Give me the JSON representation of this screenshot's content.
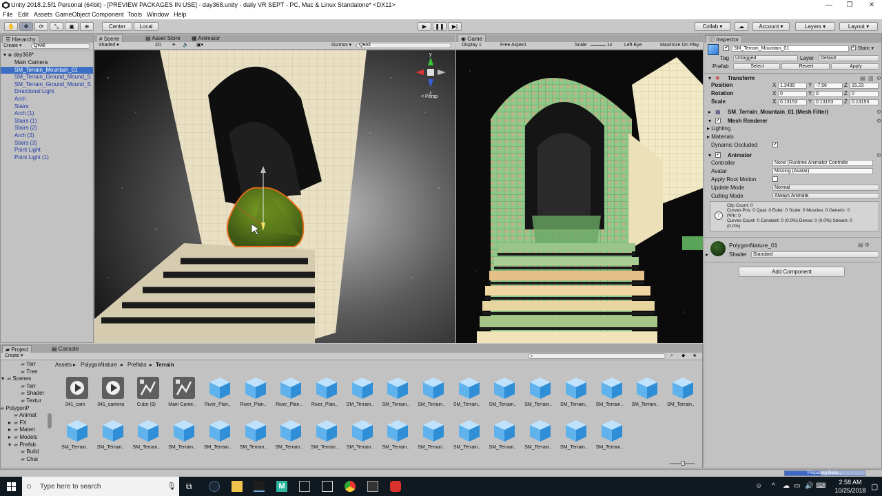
{
  "window": {
    "title": "Unity 2018.2.5f1 Personal (64bit) - [PREVIEW PACKAGES IN USE] - day368.unity - daily VR SEPT - PC, Mac & Linux Standalone* <DX11>"
  },
  "menu": [
    "File",
    "Edit",
    "Assets",
    "GameObject",
    "Component",
    "Tools",
    "Window",
    "Help"
  ],
  "toolbar": {
    "center": "Center",
    "local": "Local",
    "collab": "Collab ▾",
    "account": "Account",
    "layers": "Layers",
    "layout": "Layout"
  },
  "hierarchy": {
    "tab": "Hierarchy",
    "create": "Create ▾",
    "search": "Q▾All",
    "scene": "day368*",
    "items": [
      {
        "label": "Main Camera",
        "style": "normal"
      },
      {
        "label": "SM_Terrain_Mountain_01",
        "style": "selected"
      },
      {
        "label": "SM_Terrain_Ground_Mound_S",
        "style": "prefab"
      },
      {
        "label": "SM_Terrain_Ground_Mound_S",
        "style": "prefab"
      },
      {
        "label": "Directional Light",
        "style": "prefab"
      },
      {
        "label": "Arch",
        "style": "prefab"
      },
      {
        "label": "Stairs",
        "style": "prefab"
      },
      {
        "label": "Arch (1)",
        "style": "prefab"
      },
      {
        "label": "Stairs (1)",
        "style": "prefab"
      },
      {
        "label": "Stairs (2)",
        "style": "prefab"
      },
      {
        "label": "Arch (2)",
        "style": "prefab"
      },
      {
        "label": "Stairs (3)",
        "style": "prefab"
      },
      {
        "label": "Point Light",
        "style": "prefab"
      },
      {
        "label": "Point Light (1)",
        "style": "prefab"
      }
    ]
  },
  "scene": {
    "tabs": [
      "Scene",
      "Asset Store",
      "Animator"
    ],
    "shading": "Shaded",
    "mode2d": "2D",
    "gizmos": "Gizmos ▾",
    "search": "Q▾All",
    "persp": "< Persp",
    "axis_y": "y",
    "axis_z": "z"
  },
  "game": {
    "tab": "Game",
    "display": "Display 1",
    "aspect": "Free Aspect",
    "scale_label": "Scale",
    "scale_value": "1x",
    "eye": "Left Eye",
    "maximize": "Maximize On Play"
  },
  "inspector": {
    "tab": "Inspector",
    "object_name": "SM_Terrain_Mountain_01",
    "static": "Static ▾",
    "tag_label": "Tag",
    "tag_value": "Untagged",
    "layer_label": "Layer",
    "layer_value": "Default",
    "prefab_label": "Prefab",
    "prefab_select": "Select",
    "prefab_revert": "Revert",
    "prefab_apply": "Apply",
    "transform": {
      "title": "Transform",
      "position": {
        "label": "Position",
        "x": "1.3499",
        "y": "-7.56",
        "z": "15.23"
      },
      "rotation": {
        "label": "Rotation",
        "x": "0",
        "y": "0",
        "z": "0"
      },
      "scale": {
        "label": "Scale",
        "x": "0.13153",
        "y": "0.13153",
        "z": "0.13153"
      }
    },
    "mesh_filter": "SM_Terrain_Mountain_01 (Mesh Filter)",
    "mesh_renderer": "Mesh Renderer",
    "lighting": "Lighting",
    "materials": "Materials",
    "dynamic_occluded": "Dynamic Occluded",
    "animator": {
      "title": "Animator",
      "controller_label": "Controller",
      "controller_value": "None (Runtime Animator Controlle",
      "avatar_label": "Avatar",
      "avatar_value": "Missing (Avatar)",
      "root_motion_label": "Apply Root Motion",
      "update_label": "Update Mode",
      "update_value": "Normal",
      "culling_label": "Culling Mode",
      "culling_value": "Always Animate",
      "info_line1": "Clip Count: 0",
      "info_line2": "Curves Pos: 0 Quat: 0 Euler: 0 Scale: 0 Muscles: 0 Generic: 0",
      "info_line3": "PPtr: 0",
      "info_line4": "Curves Count: 0 Constant: 0 (0.0%) Dense: 0 (0.0%) Stream: 0",
      "info_line5": "(0.0%)"
    },
    "material_name": "PolygonNature_01",
    "shader_label": "Shader",
    "shader_value": "Standard",
    "add_component": "Add Component"
  },
  "project": {
    "tabs": [
      "Project",
      "Console"
    ],
    "create": "Create ▾",
    "tree": [
      "Terr",
      "Tree",
      "Scenes",
      "Terr",
      "Shader",
      "Textur",
      "PolygonP",
      "Animat",
      "FX",
      "Materi",
      "Models",
      "Prefab",
      "Build",
      "Chai"
    ],
    "breadcrumb": [
      "Assets",
      "PolygonNature",
      "Prefabs",
      "Terrain"
    ],
    "row1": [
      {
        "name": "341_cam",
        "kind": "clip"
      },
      {
        "name": "341_camera",
        "kind": "clip"
      },
      {
        "name": "Cube (9)",
        "kind": "anim"
      },
      {
        "name": "Main Came..",
        "kind": "anim"
      },
      {
        "name": "River_Plan..",
        "kind": "cube"
      },
      {
        "name": "River_Plan..",
        "kind": "cube"
      },
      {
        "name": "River_Plan..",
        "kind": "cube"
      },
      {
        "name": "River_Plan..",
        "kind": "cube"
      },
      {
        "name": "SM_Terrain..",
        "kind": "cube"
      },
      {
        "name": "SM_Terrain..",
        "kind": "cube"
      },
      {
        "name": "SM_Terrain..",
        "kind": "cube"
      },
      {
        "name": "SM_Terrain..",
        "kind": "cube"
      },
      {
        "name": "SM_Terrain..",
        "kind": "cube"
      },
      {
        "name": "SM_Terrain..",
        "kind": "cube"
      },
      {
        "name": "SM_Terrain..",
        "kind": "cube"
      },
      {
        "name": "SM_Terrain..",
        "kind": "cube"
      },
      {
        "name": "SM_Terrain..",
        "kind": "cube"
      },
      {
        "name": "SM_Terrain..",
        "kind": "cube"
      }
    ],
    "row2": [
      "SM_Terrain..",
      "SM_Terrain..",
      "SM_Terrain..",
      "SM_Terrain..",
      "SM_Terrain..",
      "SM_Terrain..",
      "SM_Terrain..",
      "SM_Terrain..",
      "SM_Terrain..",
      "SM_Terrain..",
      "SM_Terrain..",
      "SM_Terrain..",
      "SM_Terrain..",
      "SM_Terrain..",
      "SM_Terrain..",
      "SM_Terrain.."
    ]
  },
  "status": {
    "progress_label": "Preparing Bake...",
    "progress": 0.45
  },
  "taskbar": {
    "search_placeholder": "Type here to search",
    "time": "2:58 AM",
    "date": "10/25/2018"
  },
  "colors": {
    "selected": "#3d6fc4",
    "prefab_text": "#1d37a8",
    "unity_grey": "#c2c2c2",
    "taskbar": "#101820"
  }
}
